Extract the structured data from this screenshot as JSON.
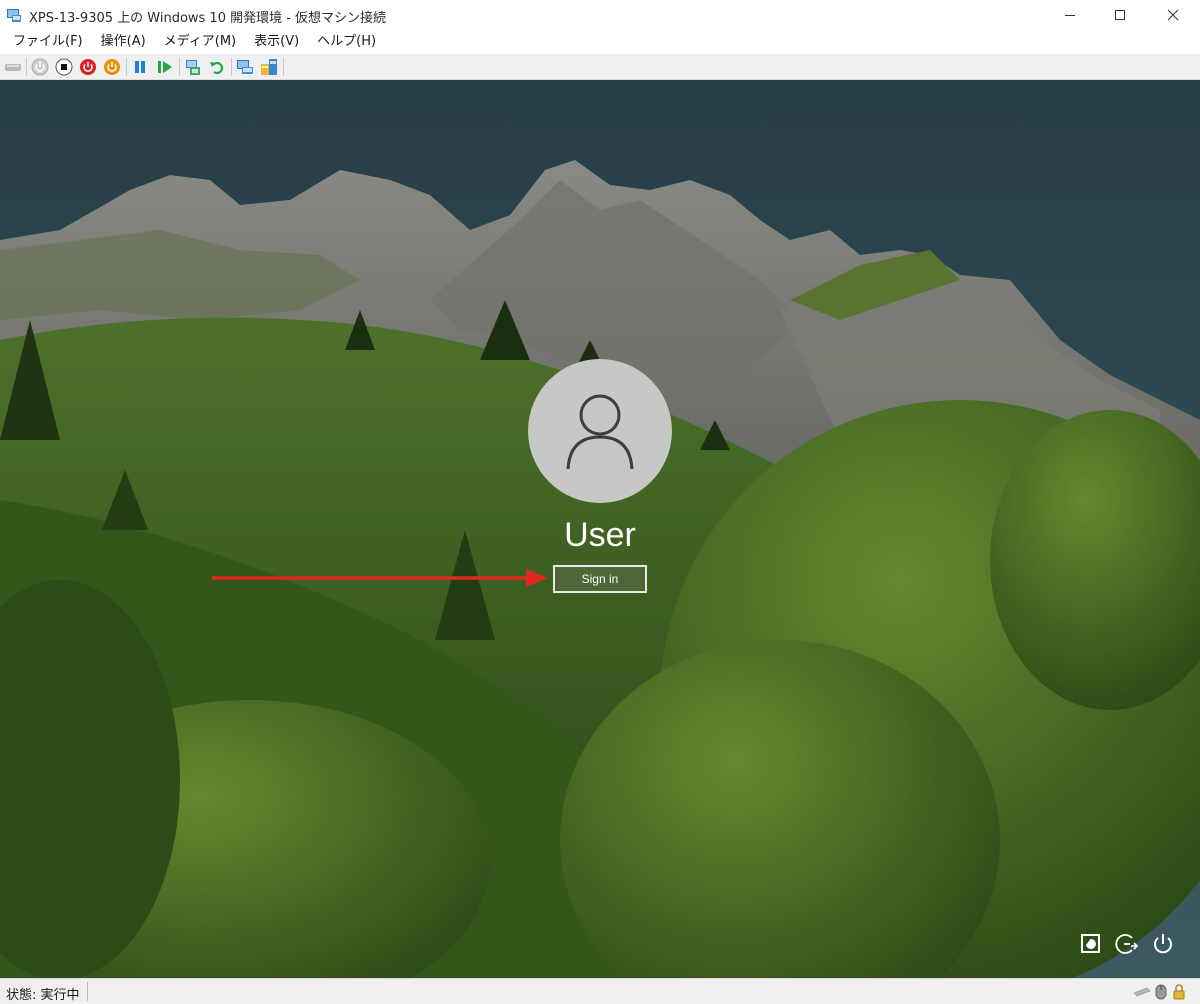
{
  "window": {
    "title": "XPS-13-9305 上の Windows 10 開発環境 - 仮想マシン接続"
  },
  "menu": {
    "items": [
      "ファイル(F)",
      "操作(A)",
      "メディア(M)",
      "表示(V)",
      "ヘルプ(H)"
    ]
  },
  "toolbar": {
    "icons": [
      "ctrl-alt-del-icon",
      "start-icon",
      "turn-off-icon",
      "shut-down-icon",
      "save-icon",
      "pause-icon",
      "resume-icon",
      "checkpoint-icon",
      "revert-icon",
      "enhanced-session-icon",
      "share-icon"
    ]
  },
  "login": {
    "username": "User",
    "signin_label": "Sign in"
  },
  "lock_screen_icons": [
    "ease-of-access-icon",
    "network-icon",
    "power-icon"
  ],
  "status": {
    "text": "状態: 実行中"
  },
  "colors": {
    "sky": "#3b5965",
    "grass": "#4f7d2b",
    "arrow": "#e0281e",
    "power_red": "#d62222",
    "power_orange": "#e8930c",
    "pause_blue": "#1f7fd6",
    "play_green": "#21a74a"
  }
}
